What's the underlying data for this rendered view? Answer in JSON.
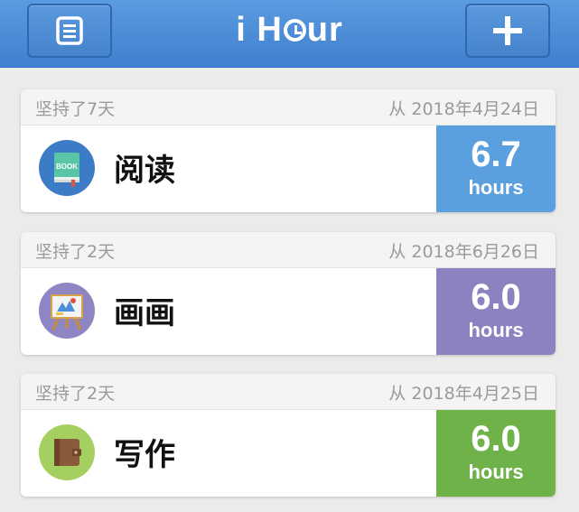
{
  "app": {
    "title_pre": "i H",
    "title_post": "ur"
  },
  "icons": {
    "menu": "list-menu-icon",
    "add": "plus-icon"
  },
  "cards": [
    {
      "streak": "坚持了7天",
      "since": "从 2018年4月24日",
      "name": "阅读",
      "hours": "6.7",
      "unit": "hours",
      "icon": "book-icon",
      "color": "#5aa0df",
      "icon_bg": "#3c7bc6"
    },
    {
      "streak": "坚持了2天",
      "since": "从 2018年6月26日",
      "name": "画画",
      "hours": "6.0",
      "unit": "hours",
      "icon": "easel-icon",
      "color": "#8b82c0",
      "icon_bg": "#8e86c2"
    },
    {
      "streak": "坚持了2天",
      "since": "从 2018年4月25日",
      "name": "写作",
      "hours": "6.0",
      "unit": "hours",
      "icon": "wallet-icon",
      "color": "#6fb24a",
      "icon_bg": "#a6cf62"
    }
  ]
}
